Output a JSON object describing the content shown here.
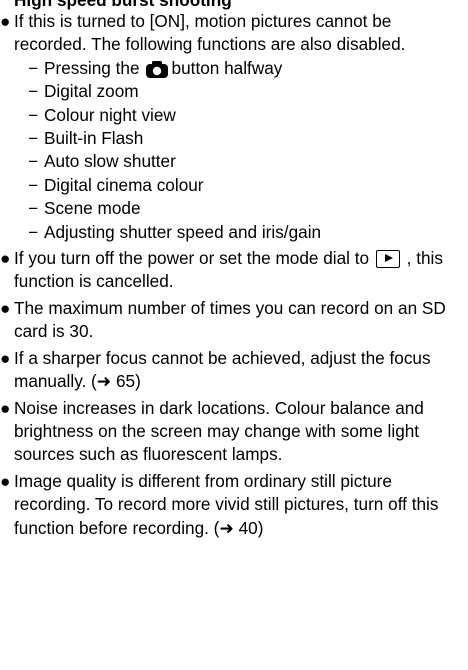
{
  "heading": "High speed burst shooting",
  "bullets": [
    {
      "text": "If this is turned to [ON], motion pictures cannot be recorded. The following functions are also disabled.",
      "subitems": [
        {
          "pre": "Pressing the",
          "icon": "camera-shutter-icon",
          "post": "button halfway"
        },
        {
          "text": "Digital zoom"
        },
        {
          "text": "Colour night view"
        },
        {
          "text": "Built-in Flash"
        },
        {
          "text": "Auto slow shutter"
        },
        {
          "text": "Digital cinema colour"
        },
        {
          "text": "Scene mode"
        },
        {
          "text": "Adjusting shutter speed and iris/gain"
        }
      ]
    },
    {
      "pre": "If you turn off the power or set the mode dial to",
      "icon": "playback-mode-icon",
      "post": ", this function is cancelled."
    },
    {
      "text": "The maximum number of times you can record on an SD card is 30."
    },
    {
      "text": "If a sharper focus cannot be achieved, adjust the focus manually. (➜ 65)"
    },
    {
      "text": "Noise increases in dark locations. Colour balance and brightness on the screen may change with some light sources such as fluorescent lamps."
    },
    {
      "text": "Image quality is different from ordinary still picture recording. To record more vivid still pictures, turn off this function before recording. (➜ 40)"
    }
  ],
  "bullet_glyph": "●",
  "dash_glyph": "−"
}
